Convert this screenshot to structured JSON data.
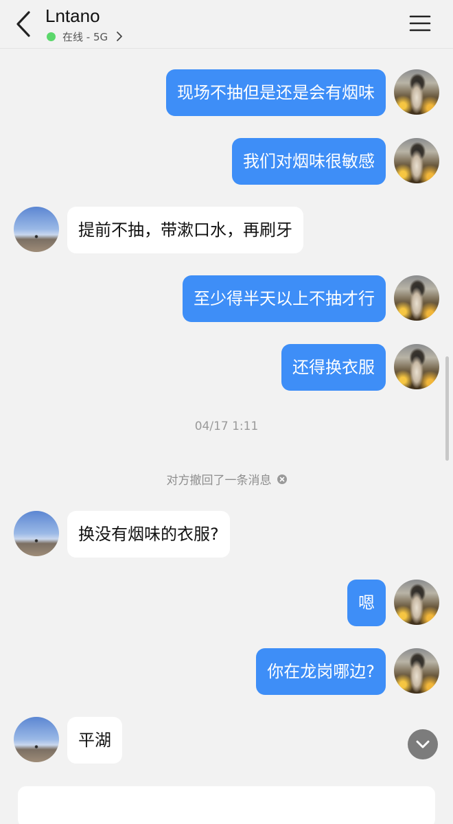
{
  "header": {
    "title": "Lntano",
    "status": "在线 - 5G",
    "status_color": "#5bd76b"
  },
  "colors": {
    "outgoing_bubble": "#3e8ef7",
    "incoming_bubble": "#ffffff",
    "background": "#f2f2f2"
  },
  "messages": [
    {
      "direction": "out",
      "text": "现场不抽但是还是会有烟味"
    },
    {
      "direction": "out",
      "text": "我们对烟味很敏感"
    },
    {
      "direction": "in",
      "text": "提前不抽，带漱口水，再刷牙"
    },
    {
      "direction": "out",
      "text": "至少得半天以上不抽才行"
    },
    {
      "direction": "out",
      "text": "还得换衣服"
    },
    {
      "direction": "in",
      "text": "换没有烟味的衣服?"
    },
    {
      "direction": "out",
      "text": "嗯"
    },
    {
      "direction": "out",
      "text": "你在龙岗哪边?"
    },
    {
      "direction": "in",
      "text": "平湖"
    }
  ],
  "timestamp": "04/17 1:11",
  "recall_notice": "对方撤回了一条消息",
  "icons": {
    "back": "chevron-left-icon",
    "status_chevron": "chevron-right-icon",
    "menu": "hamburger-menu-icon",
    "recall": "close-circle-icon",
    "scroll_down": "chevron-down-icon"
  },
  "input": {
    "placeholder": "",
    "value": ""
  }
}
